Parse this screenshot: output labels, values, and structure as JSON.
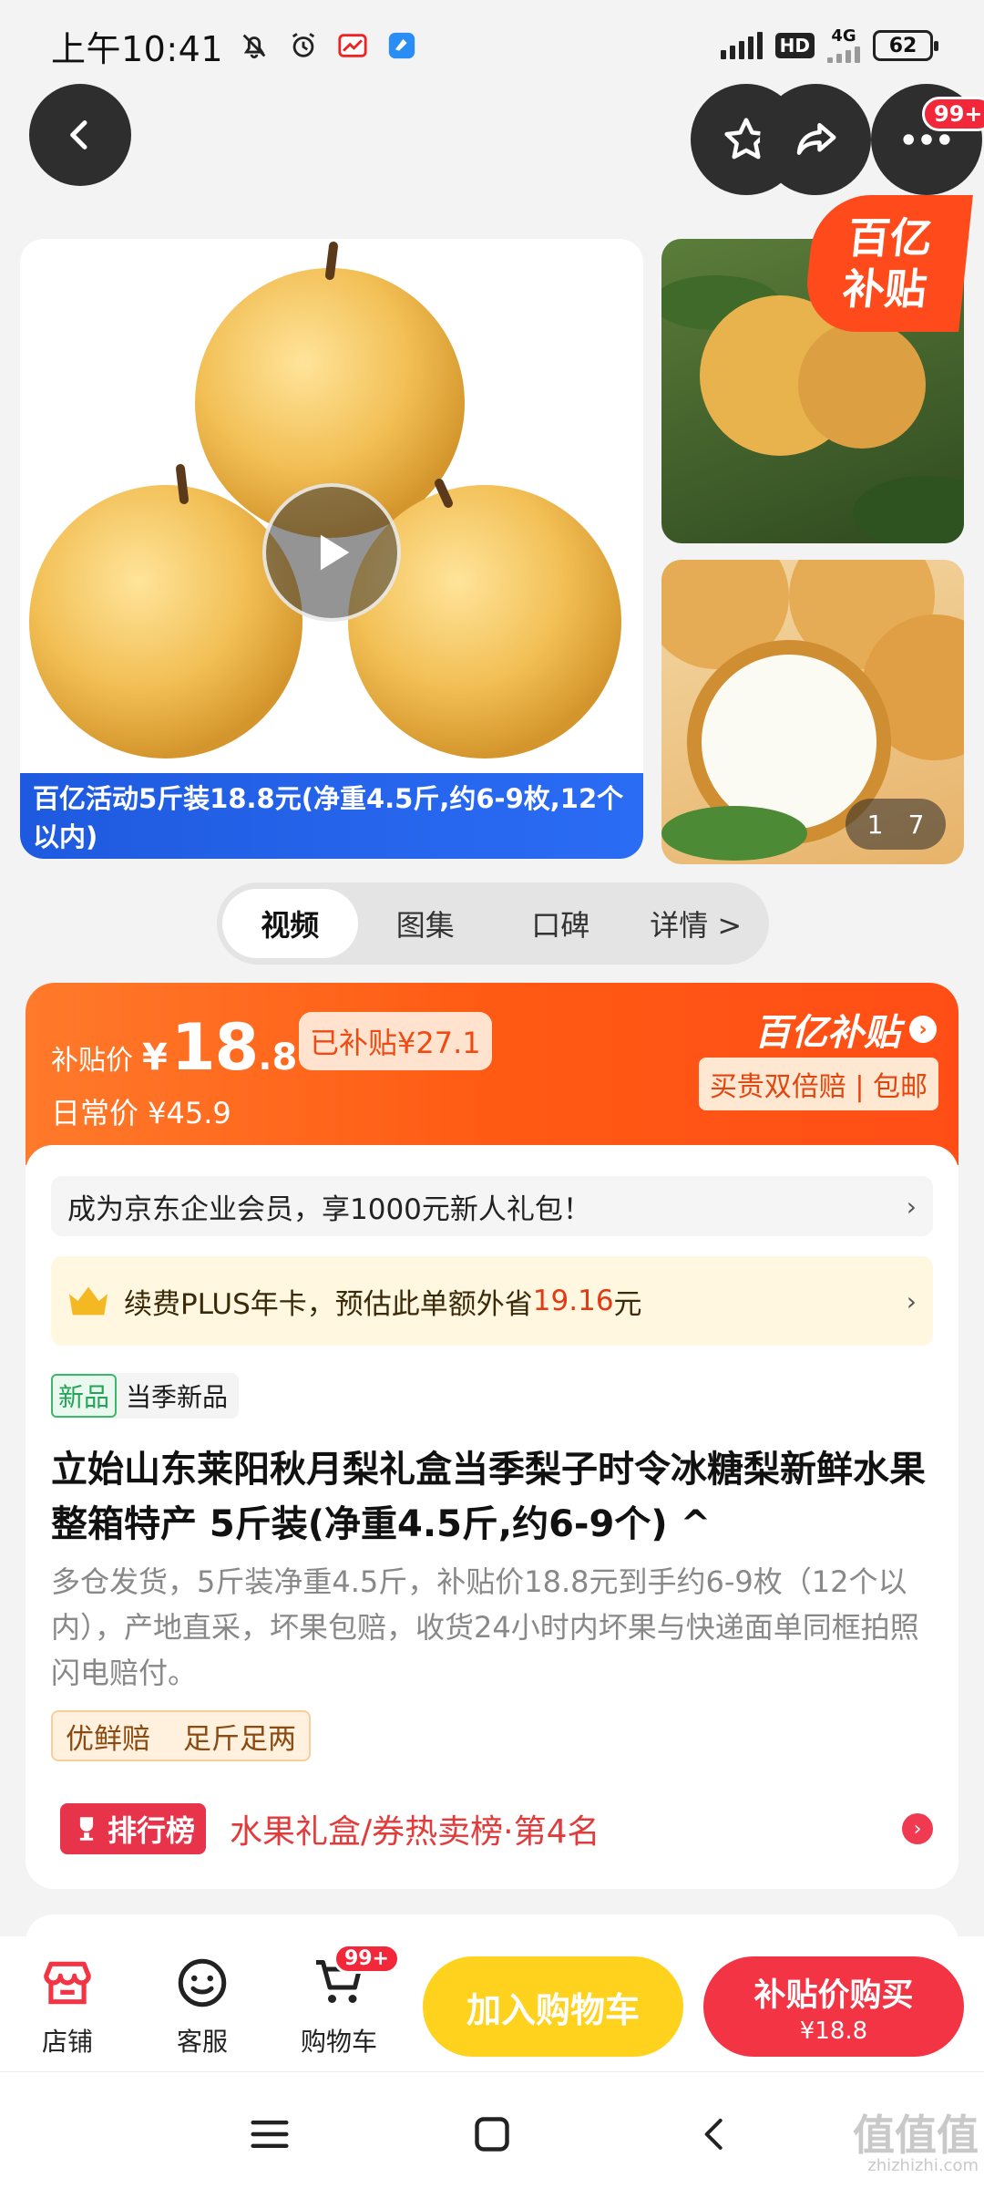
{
  "status_bar": {
    "time": "上午10:41",
    "network": "4G",
    "hd": "HD",
    "battery": "62"
  },
  "nav": {
    "more_badge": "99+"
  },
  "gallery": {
    "main_caption": "百亿活动5斤装18.8元(净重4.5斤,约6-9枚,12个以内)",
    "corner_badge_line1": "百亿",
    "corner_badge_line2": "补贴",
    "counter_current": "1",
    "counter_total": "7"
  },
  "tabs": [
    {
      "label": "视频"
    },
    {
      "label": "图集"
    },
    {
      "label": "口碑"
    },
    {
      "label": "详情 >"
    }
  ],
  "price": {
    "label": "补贴价",
    "currency": "¥",
    "integer": "18",
    "decimal": ".8",
    "subsidy_tag": "已补贴¥27.1",
    "regular": "日常价 ¥45.9",
    "brand": "百亿补贴",
    "brand_sub": "买贵双倍赔 | 包邮"
  },
  "promos": {
    "member": "成为京东企业会员，享1000元新人礼包！",
    "plus_prefix": "续费PLUS年卡，预估此单额外省",
    "plus_amount": "19.16",
    "plus_suffix": "元"
  },
  "product": {
    "new_tag": "新品",
    "new_label": "当季新品",
    "title": "立始山东莱阳秋月梨礼盒当季梨子时令冰糖梨新鲜水果整箱特产 5斤装(净重4.5斤,约6-9个) ^",
    "description": "多仓发货，5斤装净重4.5斤，补贴价18.8元到手约6-9枚（12个以内），产地直采，坏果包赔，收货24小时内坏果与快递面单同框拍照闪电赔付。",
    "guarantee_1": "优鲜赔",
    "guarantee_2": "足斤足两",
    "rank_badge": "排行榜",
    "rank_text": "水果礼盒/券热卖榜·第4名"
  },
  "action_bar": {
    "store": "店铺",
    "service": "客服",
    "cart": "购物车",
    "cart_badge": "99+",
    "add_to_cart": "加入购物车",
    "buy_label": "补贴价购买",
    "buy_price": "¥18.8"
  },
  "watermark": {
    "main": "值值值",
    "sub": "zhizhizhi.com"
  },
  "colors": {
    "accent_orange": "#ff5a14",
    "accent_red": "#f23444",
    "accent_yellow": "#ffd21e",
    "blue_caption": "#1e5adf"
  }
}
